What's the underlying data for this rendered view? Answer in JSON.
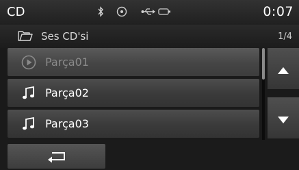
{
  "status": {
    "source": "CD",
    "time": "0:07",
    "icons": [
      "bluetooth-icon",
      "disc-icon",
      "usb-icon",
      "battery-icon"
    ]
  },
  "header": {
    "folder_icon": "folder-icon",
    "title": "Ses CD'si",
    "page": "1/4"
  },
  "tracks": [
    {
      "label": "Parça01",
      "icon": "play-circle-icon",
      "state": "current"
    },
    {
      "label": "Parça02",
      "icon": "music-note-icon",
      "state": "normal"
    },
    {
      "label": "Parça03",
      "icon": "music-note-icon",
      "state": "normal"
    }
  ],
  "scroll": {
    "up_icon": "arrow-up-icon",
    "down_icon": "arrow-down-icon"
  },
  "footer": {
    "back_icon": "back-arrow-icon"
  },
  "colors": {
    "background": "#1a1a1a",
    "row": "#3a3a3a",
    "text": "#ffffff",
    "dim_text": "#8a8a8a"
  }
}
